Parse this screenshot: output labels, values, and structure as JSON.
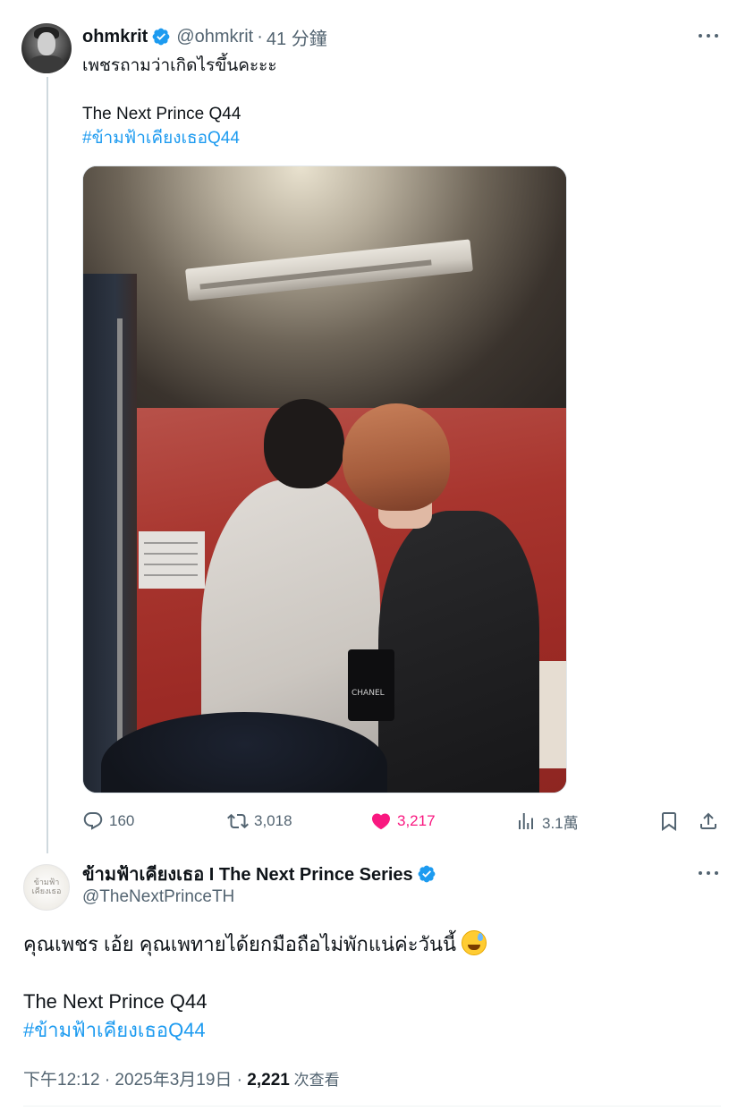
{
  "colors": {
    "accent": "#1d9bf0",
    "like": "#f91880",
    "secondary": "#536471",
    "text": "#0f1419"
  },
  "tweet1": {
    "author_name": "ohmkrit",
    "handle": "@ohmkrit",
    "separator": "·",
    "time": "41 分鐘",
    "text_line1": "เพชรถามว่าเกิดไรขึ้นคะะะ",
    "text_line2": "The Next Prince Q44",
    "hashtag": "#ข้ามฟ้าเคียงเธอQ44",
    "media_bag_text": "CHANEL",
    "actions": {
      "reply_count": "160",
      "retweet_count": "3,018",
      "like_count": "3,217",
      "views": "3.1萬"
    }
  },
  "tweet2": {
    "author_name": "ข้ามฟ้าเคียงเธอ I The Next Prince Series",
    "handle": "@TheNextPrinceTH",
    "avatar_text": "ข้ามฟ้า เคียงเธอ",
    "text_line1": "คุณเพชร เอ้ย คุณเพทายได้ยกมือถือไม่พักแน่ค่ะวันนี้",
    "emoji": "sweat-smile-emoji",
    "text_line2": "The Next Prince Q44",
    "hashtag": "#ข้ามฟ้าเคียงเธอQ44",
    "timestamp": "下午12:12 · 2025年3月19日 · ",
    "views_count": "2,221",
    "views_label": " 次查看"
  },
  "icons": [
    "verified-icon",
    "more-icon",
    "reply-icon",
    "retweet-icon",
    "like-icon",
    "views-icon",
    "bookmark-icon",
    "share-icon"
  ]
}
